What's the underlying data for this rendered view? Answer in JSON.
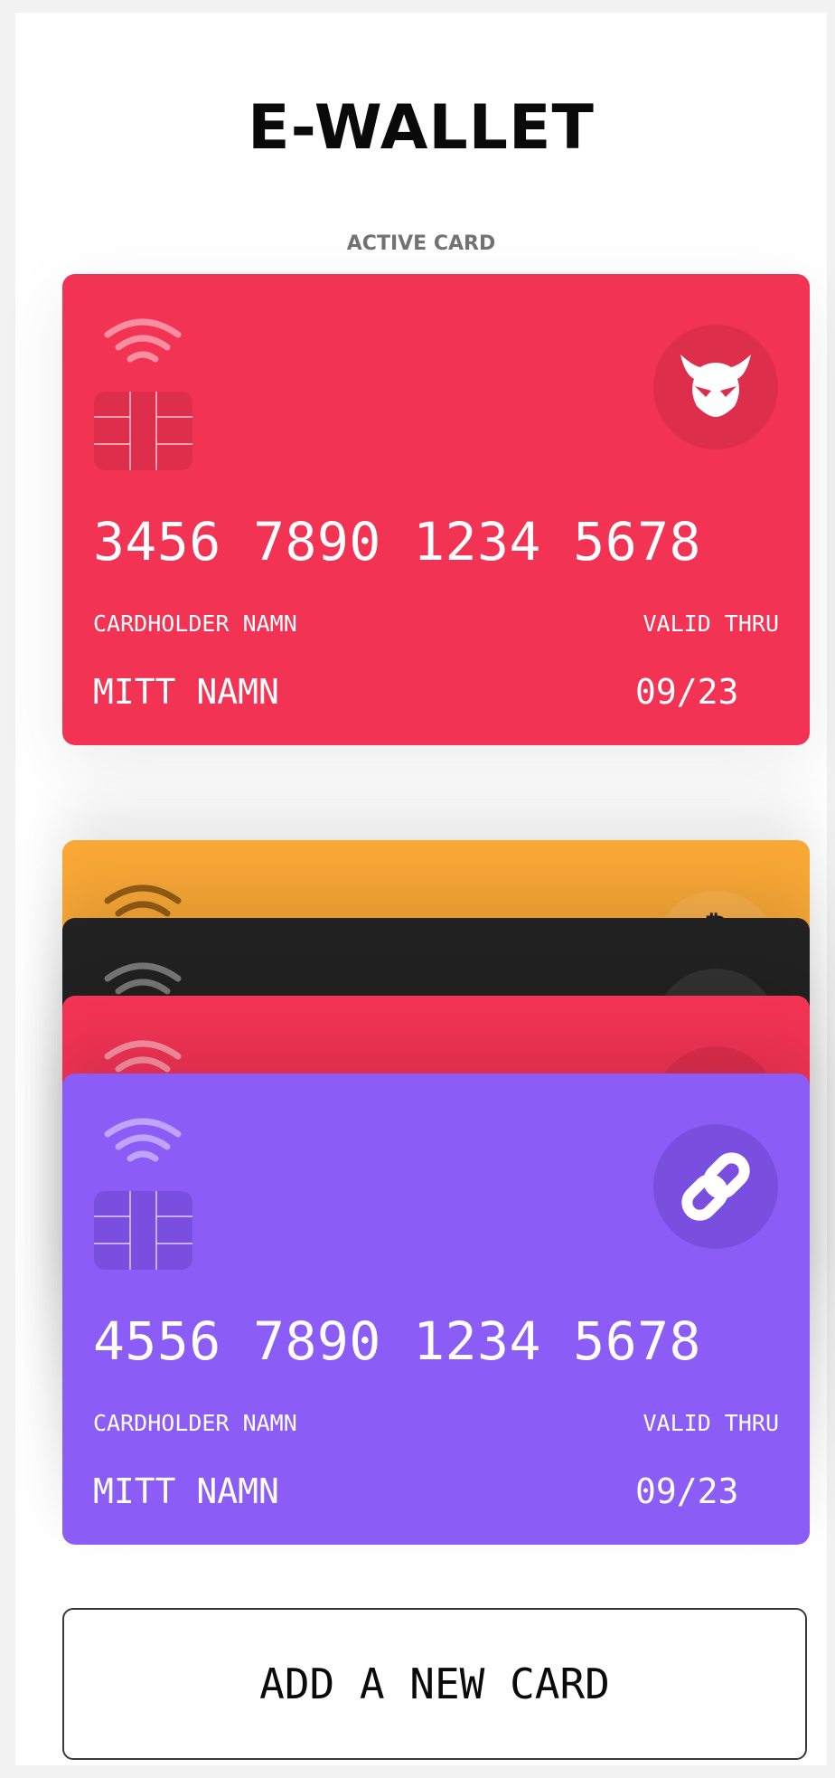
{
  "app": {
    "title": "E-WALLET",
    "active_label": "ACTIVE CARD"
  },
  "active_card": {
    "color": "#f23354",
    "vendor_icon": "ninja-icon",
    "number": "3456 7890 1234 5678",
    "holder_label": "CARDHOLDER NAMN",
    "valid_label": "VALID THRU",
    "holder_name": "MITT NAMN",
    "valid_thru": "09/23"
  },
  "stack": {
    "cards": [
      {
        "color": "#f9a836",
        "vendor_icon": "bitcoin-icon"
      },
      {
        "color": "#222222",
        "vendor_icon": "chip-icon"
      },
      {
        "color": "#f23354",
        "vendor_icon": "ninja-icon"
      }
    ],
    "front_card": {
      "color": "#8b5cf6",
      "vendor_icon": "link-icon",
      "number": "4556 7890 1234 5678",
      "holder_label": "CARDHOLDER NAMN",
      "valid_label": "VALID THRU",
      "holder_name": "MITT NAMN",
      "valid_thru": "09/23"
    }
  },
  "add_button": {
    "label": "ADD A NEW CARD"
  }
}
